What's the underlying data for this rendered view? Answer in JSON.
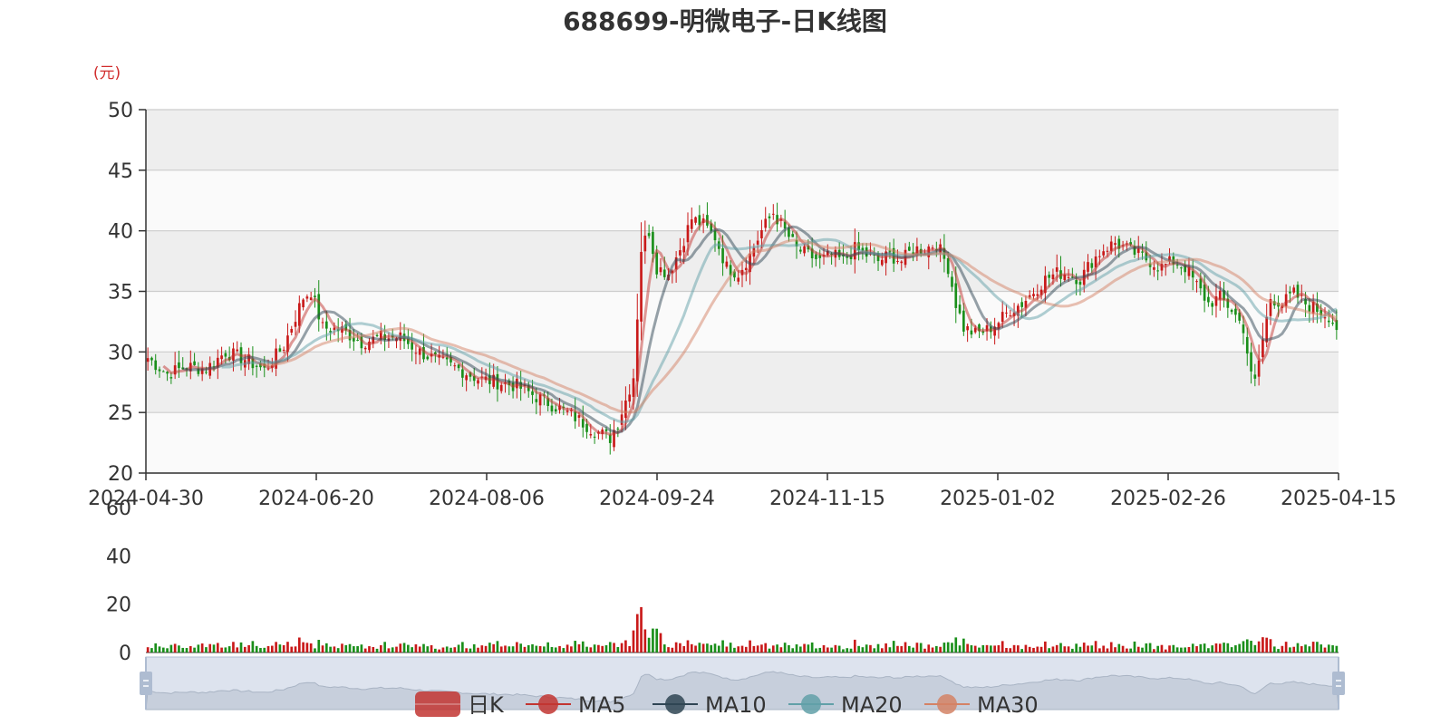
{
  "chart_data": {
    "type": "candlestick",
    "title": "688699-明微电子-日K线图",
    "unit_label": "(元)",
    "price_axis": {
      "ylim": [
        20,
        50
      ],
      "ticks": [
        "50",
        "45",
        "40",
        "35",
        "30",
        "25",
        "20"
      ]
    },
    "volume_axis": {
      "ylim": [
        0,
        60
      ],
      "ticks": [
        "60",
        "40",
        "20",
        "0"
      ]
    },
    "x_tick_labels": [
      "2024-04-30",
      "2024-06-20",
      "2024-08-06",
      "2024-09-24",
      "2024-11-15",
      "2025-01-02",
      "2025-02-26",
      "2025-04-15"
    ],
    "grid": true,
    "legend_position": "bottom-center",
    "legend": [
      {
        "name": "日K",
        "color": "#c23531"
      },
      {
        "name": "MA5",
        "color": "#c23531"
      },
      {
        "name": "MA10",
        "color": "#2f4554"
      },
      {
        "name": "MA20",
        "color": "#61a0a8"
      },
      {
        "name": "MA30",
        "color": "#d48265"
      }
    ],
    "colors": {
      "up": "#c91919",
      "down": "#1a8f1a",
      "slider_bg": "#dde3ee",
      "slider_border": "#aebcd1"
    },
    "close_anchors": [
      [
        0,
        29.5
      ],
      [
        5,
        28.2
      ],
      [
        10,
        28.8
      ],
      [
        15,
        28.6
      ],
      [
        20,
        30.0
      ],
      [
        25,
        29.4
      ],
      [
        30,
        28.5
      ],
      [
        35,
        30.5
      ],
      [
        40,
        34.5
      ],
      [
        42,
        35.0
      ],
      [
        45,
        32.0
      ],
      [
        50,
        31.8
      ],
      [
        55,
        30.8
      ],
      [
        60,
        31.2
      ],
      [
        65,
        31.2
      ],
      [
        70,
        30.0
      ],
      [
        75,
        29.2
      ],
      [
        80,
        28.6
      ],
      [
        85,
        27.8
      ],
      [
        90,
        27.5
      ],
      [
        95,
        27.2
      ],
      [
        100,
        26.3
      ],
      [
        105,
        25.5
      ],
      [
        110,
        24.6
      ],
      [
        115,
        23.5
      ],
      [
        119,
        22.9
      ],
      [
        121,
        24.2
      ],
      [
        123,
        26.0
      ],
      [
        125,
        28.0
      ],
      [
        126,
        33.0
      ],
      [
        127,
        38.5
      ],
      [
        129,
        40.0
      ],
      [
        131,
        37.0
      ],
      [
        134,
        36.5
      ],
      [
        137,
        38.5
      ],
      [
        140,
        41.0
      ],
      [
        143,
        40.5
      ],
      [
        146,
        39.5
      ],
      [
        149,
        37.0
      ],
      [
        152,
        36.5
      ],
      [
        155,
        38.0
      ],
      [
        158,
        40.0
      ],
      [
        161,
        41.5
      ],
      [
        164,
        40.0
      ],
      [
        167,
        38.5
      ],
      [
        170,
        38.0
      ],
      [
        173,
        37.5
      ],
      [
        176,
        38.0
      ],
      [
        179,
        37.5
      ],
      [
        182,
        38.5
      ],
      [
        185,
        38.0
      ],
      [
        188,
        37.5
      ],
      [
        191,
        38.0
      ],
      [
        194,
        37.5
      ],
      [
        197,
        38.5
      ],
      [
        200,
        38.5
      ],
      [
        203,
        39.0
      ],
      [
        206,
        37.0
      ],
      [
        208,
        34.0
      ],
      [
        210,
        32.0
      ],
      [
        213,
        31.5
      ],
      [
        216,
        31.8
      ],
      [
        219,
        32.5
      ],
      [
        222,
        33.5
      ],
      [
        225,
        34.0
      ],
      [
        228,
        35.0
      ],
      [
        231,
        36.0
      ],
      [
        234,
        36.5
      ],
      [
        237,
        36.5
      ],
      [
        240,
        36.0
      ],
      [
        243,
        37.5
      ],
      [
        246,
        38.5
      ],
      [
        249,
        39.0
      ],
      [
        252,
        38.5
      ],
      [
        255,
        38.0
      ],
      [
        258,
        37.5
      ],
      [
        261,
        37.0
      ],
      [
        264,
        37.5
      ],
      [
        267,
        37.0
      ],
      [
        270,
        35.5
      ],
      [
        273,
        34.0
      ],
      [
        276,
        34.5
      ],
      [
        279,
        33.5
      ],
      [
        282,
        32.0
      ],
      [
        284,
        28.0
      ],
      [
        285,
        27.5
      ],
      [
        287,
        31.0
      ],
      [
        289,
        34.5
      ],
      [
        292,
        34.0
      ],
      [
        295,
        34.8
      ],
      [
        298,
        34.0
      ],
      [
        301,
        33.5
      ],
      [
        304,
        33.0
      ],
      [
        306,
        32.0
      ]
    ]
  }
}
